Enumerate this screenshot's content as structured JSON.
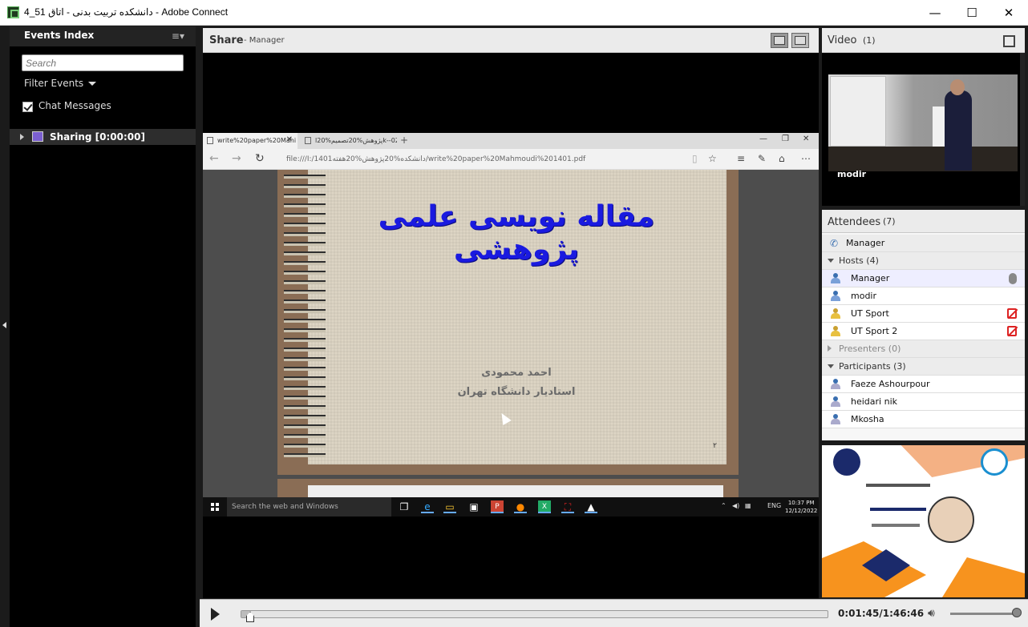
{
  "window": {
    "title": "دانشکده تربیت بدنی - اتاق 51_4 - Adobe Connect",
    "minimize": "—",
    "maximize": "☐",
    "close": "✕"
  },
  "events": {
    "title": "Events Index",
    "search_placeholder": "Search",
    "filter_label": "Filter Events",
    "chat_label": "Chat Messages",
    "chat_checked": true,
    "sharing_label": "Sharing [0:00:00]"
  },
  "share": {
    "title": "Share",
    "subtitle": "- Manager"
  },
  "browser": {
    "tabs": [
      {
        "label": "write%20paper%20Mahi"
      },
      {
        "label": "پژوهش%20تصمیم%20اk--02ی"
      }
    ],
    "url": "file:///I:/1401دانشکده%20پژوهش%20هفته/write%20paper%20Mahmoudi%201401.pdf",
    "slide_title": "مقاله نویسی علمی پژوهشی",
    "slide_author": "احمد محمودی",
    "slide_affil": "استادیار دانشگاه تهران",
    "slide_num": "۲"
  },
  "taskbar": {
    "search_placeholder": "Search the web and Windows",
    "lang": "ENG",
    "time": "10:37 PM",
    "date": "12/12/2022"
  },
  "video": {
    "title": "Video",
    "count": "(1)",
    "cam_label": "modir"
  },
  "attendees": {
    "title": "Attendees",
    "count": "(7)",
    "presenter_row": "Manager",
    "hosts_label": "Hosts (4)",
    "hosts": [
      {
        "name": "Manager"
      },
      {
        "name": "modir"
      },
      {
        "name": "UT Sport"
      },
      {
        "name": "UT Sport 2"
      }
    ],
    "presenters_label": "Presenters (0)",
    "participants_label": "Participants (3)",
    "participants": [
      {
        "name": "Faeze Ashourpour"
      },
      {
        "name": "heidari nik"
      },
      {
        "name": "Mkosha"
      }
    ]
  },
  "player": {
    "time": "0:01:45/1:46:46",
    "progress": 0.0164
  }
}
